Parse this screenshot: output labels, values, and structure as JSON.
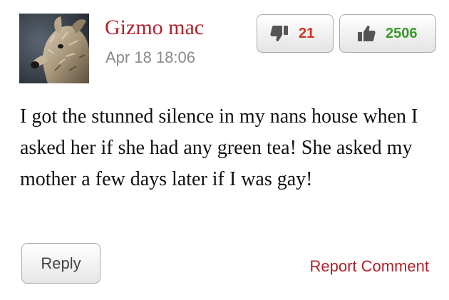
{
  "comment": {
    "author": "Gizmo mac",
    "timestamp": "Apr 18 18:06",
    "dislike_count": "21",
    "like_count": "2506",
    "text": "I got the stunned silence in my nans house when I asked her if she had any green tea! She asked my mother a few days later if I was gay!",
    "reply_label": "Reply",
    "report_label": "Report Comment"
  },
  "icons": {
    "dislike": "thumbs-down-icon",
    "like": "thumbs-up-icon"
  },
  "colors": {
    "author": "#b3202c",
    "dislike": "#d8321e",
    "like": "#3a9a2a",
    "report": "#b3202c"
  }
}
